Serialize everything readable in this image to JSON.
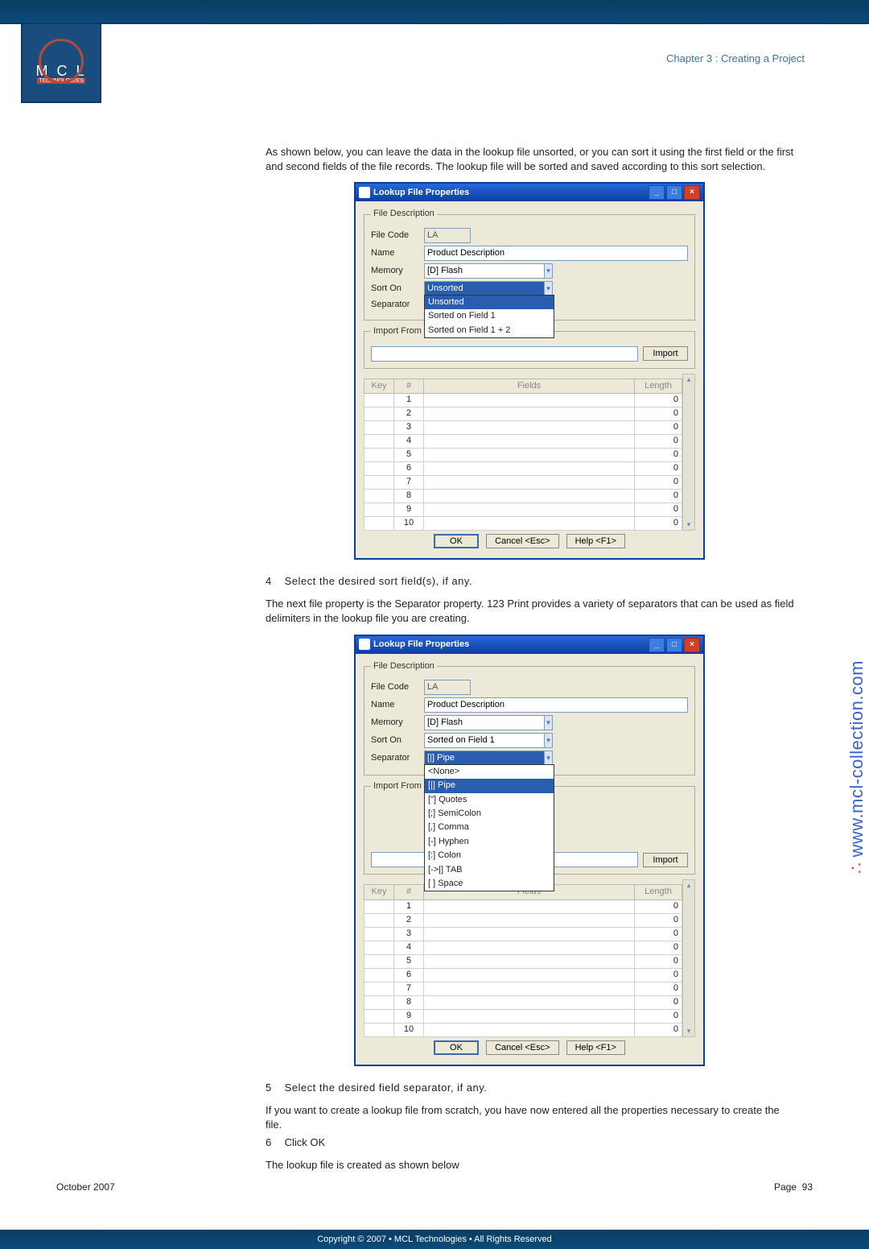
{
  "header": {
    "chapter": "Chapter 3 : Creating a Project",
    "logo_letters": "M C L",
    "logo_sub": "TECHNOLOGIES"
  },
  "text": {
    "p1": "As shown below, you can leave the data in the lookup file unsorted, or you can sort it using the first field or the first and second fields of the file records. The lookup file will be sorted and saved according to this sort selection.",
    "step4_num": "4",
    "step4": "Select the desired sort field(s), if any.",
    "p2": "The next file property is the Separator property. 123 Print provides a variety of separators that can be used as field delimiters in the lookup file you are creating.",
    "step5_num": "5",
    "step5": "Select the desired field separator, if any.",
    "p3": "If you want to create a lookup file from scratch, you have now entered all the properties necessary to create the file.",
    "step6_num": "6",
    "step6": "Click OK",
    "p4": "The lookup file is created as shown below"
  },
  "dialog": {
    "title": "Lookup File Properties",
    "fs_desc": "File Description",
    "fs_import": "Import From",
    "lbl_filecode": "File Code",
    "lbl_name": "Name",
    "lbl_memory": "Memory",
    "lbl_sorton": "Sort On",
    "lbl_separator": "Separator",
    "val_filecode": "LA",
    "val_name": "Product Description",
    "val_memory": "[D] Flash",
    "val_sorton_a": "Unsorted",
    "val_sorton_b": "Sorted on Field 1",
    "val_separator_b": "[|] Pipe",
    "btn_import": "Import",
    "col_key": "Key",
    "col_num": "#",
    "col_fields": "Fields",
    "col_length": "Length",
    "rows": [
      "1",
      "2",
      "3",
      "4",
      "5",
      "6",
      "7",
      "8",
      "9",
      "10"
    ],
    "len_zero": "0",
    "btn_ok": "OK",
    "btn_cancel": "Cancel <Esc>",
    "btn_help": "Help <F1>",
    "sort_options": [
      "Unsorted",
      "Sorted on Field 1",
      "Sorted on Field 1 + 2"
    ],
    "sep_options": [
      "<None>",
      "[|] Pipe",
      "[\"] Quotes",
      "[;] SemiColon",
      "[,] Comma",
      "[-] Hyphen",
      "[:] Colon",
      "[->|] TAB",
      "[ ] Space"
    ]
  },
  "footer": {
    "date": "October 2007",
    "page_label": "Page",
    "page_num": "93",
    "copyright": "Copyright © 2007 • MCL Technologies • All Rights Reserved",
    "url": "www.mcl-collection.com"
  }
}
